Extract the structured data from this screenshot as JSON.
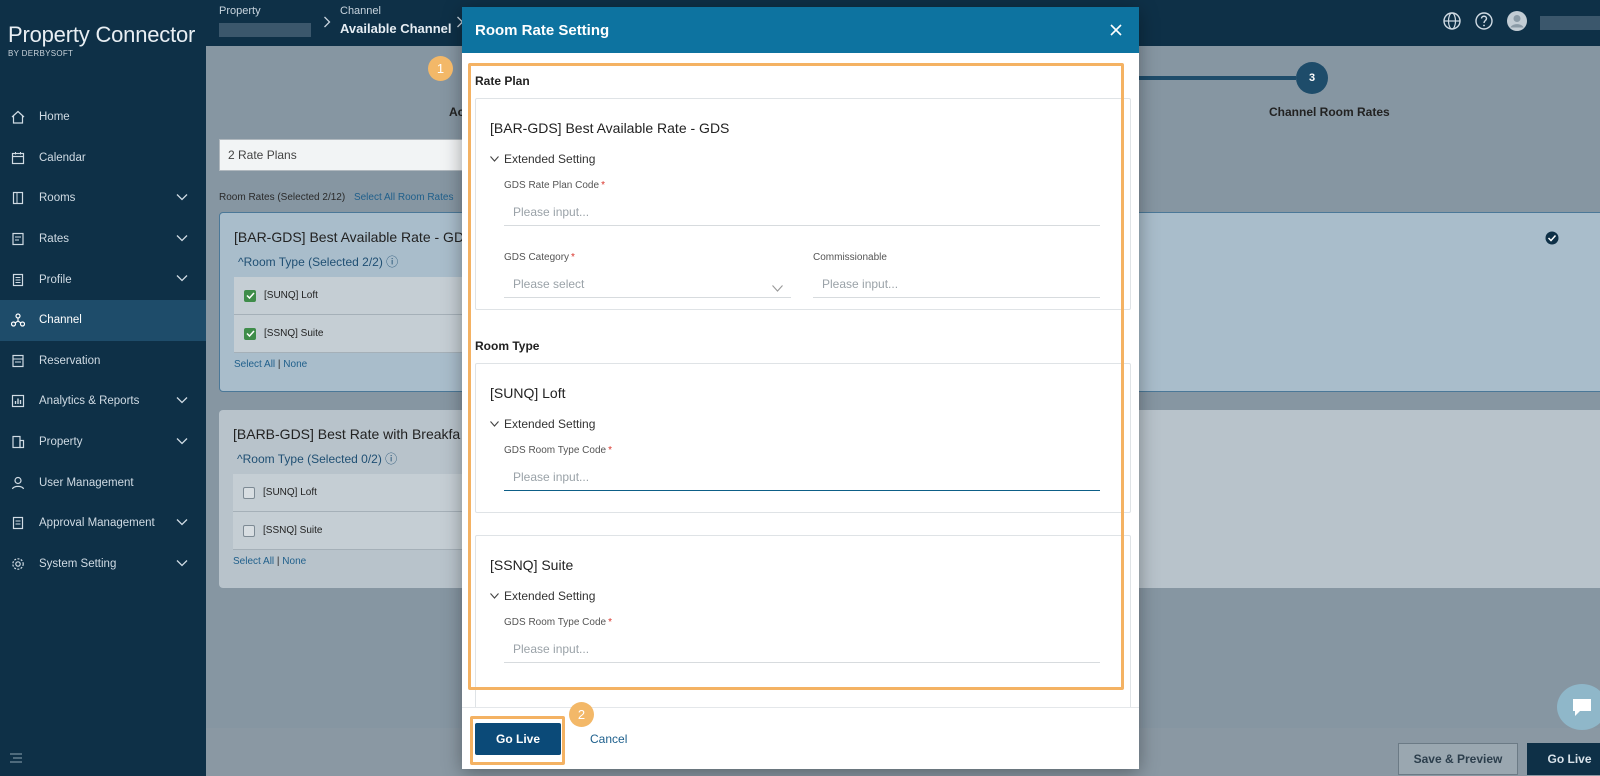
{
  "app": {
    "logo_main": "Property Connector",
    "logo_sub": "BY DERBYSOFT"
  },
  "sidebar": {
    "items": [
      {
        "label": "Home",
        "icon": "home-icon",
        "chevron": false,
        "active": false
      },
      {
        "label": "Calendar",
        "icon": "calendar-icon",
        "chevron": false,
        "active": false
      },
      {
        "label": "Rooms",
        "icon": "door-icon",
        "chevron": true,
        "active": false
      },
      {
        "label": "Rates",
        "icon": "rates-icon",
        "chevron": true,
        "active": false
      },
      {
        "label": "Profile",
        "icon": "profile-doc-icon",
        "chevron": true,
        "active": false
      },
      {
        "label": "Channel",
        "icon": "channel-network-icon",
        "chevron": false,
        "active": true
      },
      {
        "label": "Reservation",
        "icon": "reservation-icon",
        "chevron": false,
        "active": false
      },
      {
        "label": "Analytics & Reports",
        "icon": "analytics-icon",
        "chevron": true,
        "active": false
      },
      {
        "label": "Property",
        "icon": "building-icon",
        "chevron": true,
        "active": false
      },
      {
        "label": "User Management",
        "icon": "user-icon",
        "chevron": false,
        "active": false
      },
      {
        "label": "Approval Management",
        "icon": "approval-icon",
        "chevron": true,
        "active": false
      },
      {
        "label": "System Setting",
        "icon": "gear-icon",
        "chevron": true,
        "active": false
      }
    ]
  },
  "topbar": {
    "crumb_property_label": "Property",
    "crumb_channel_label": "Channel",
    "crumb_channel_value": "Available Channel"
  },
  "background": {
    "step3_number": "3",
    "step3_label": "Channel Room Rates",
    "step1_label_partial": "Ac",
    "rate_plan_select": "2 Rate Plans",
    "room_rates_selected": "Room Rates (Selected 2/12)",
    "select_all_room_rates": "Select All Room Rates",
    "card1_title": "[BAR-GDS] Best Available Rate - GD",
    "card1_room_type": "Room Type (Selected 2/2)",
    "card1_rooms": [
      "[SUNQ] Loft",
      "[SSNQ] Suite"
    ],
    "card2_title": "[BARB-GDS] Best Rate with Breakfa",
    "card2_room_type": "Room Type (Selected 0/2)",
    "card2_rooms": [
      "[SUNQ] Loft",
      "[SSNQ] Suite"
    ],
    "select_all": "Select All",
    "none": "None",
    "save_preview": "Save & Preview",
    "go_live": "Go Live"
  },
  "modal": {
    "title": "Room Rate Setting",
    "rate_plan_section": "Rate Plan",
    "rate_plan_card": {
      "title": "[BAR-GDS] Best Available Rate - GDS",
      "extended": "Extended Setting",
      "gds_rate_plan_code_label": "GDS Rate Plan Code",
      "gds_rate_plan_code_placeholder": "Please input...",
      "gds_category_label": "GDS Category",
      "gds_category_placeholder": "Please select",
      "commissionable_label": "Commissionable",
      "commissionable_placeholder": "Please input..."
    },
    "room_type_section": "Room Type",
    "room_cards": [
      {
        "title": "[SUNQ] Loft",
        "extended": "Extended Setting",
        "label": "GDS Room Type Code",
        "placeholder": "Please input..."
      },
      {
        "title": "[SSNQ] Suite",
        "extended": "Extended Setting",
        "label": "GDS Room Type Code",
        "placeholder": "Please input..."
      }
    ],
    "go_live": "Go Live",
    "cancel": "Cancel"
  },
  "annotations": {
    "badge1": "1",
    "badge2": "2"
  },
  "colors": {
    "sidebar_bg": "#0e3047",
    "modal_header": "#0d73a0",
    "primary_button": "#0b4a78",
    "highlight": "#f4b263",
    "required": "#d9342b"
  }
}
